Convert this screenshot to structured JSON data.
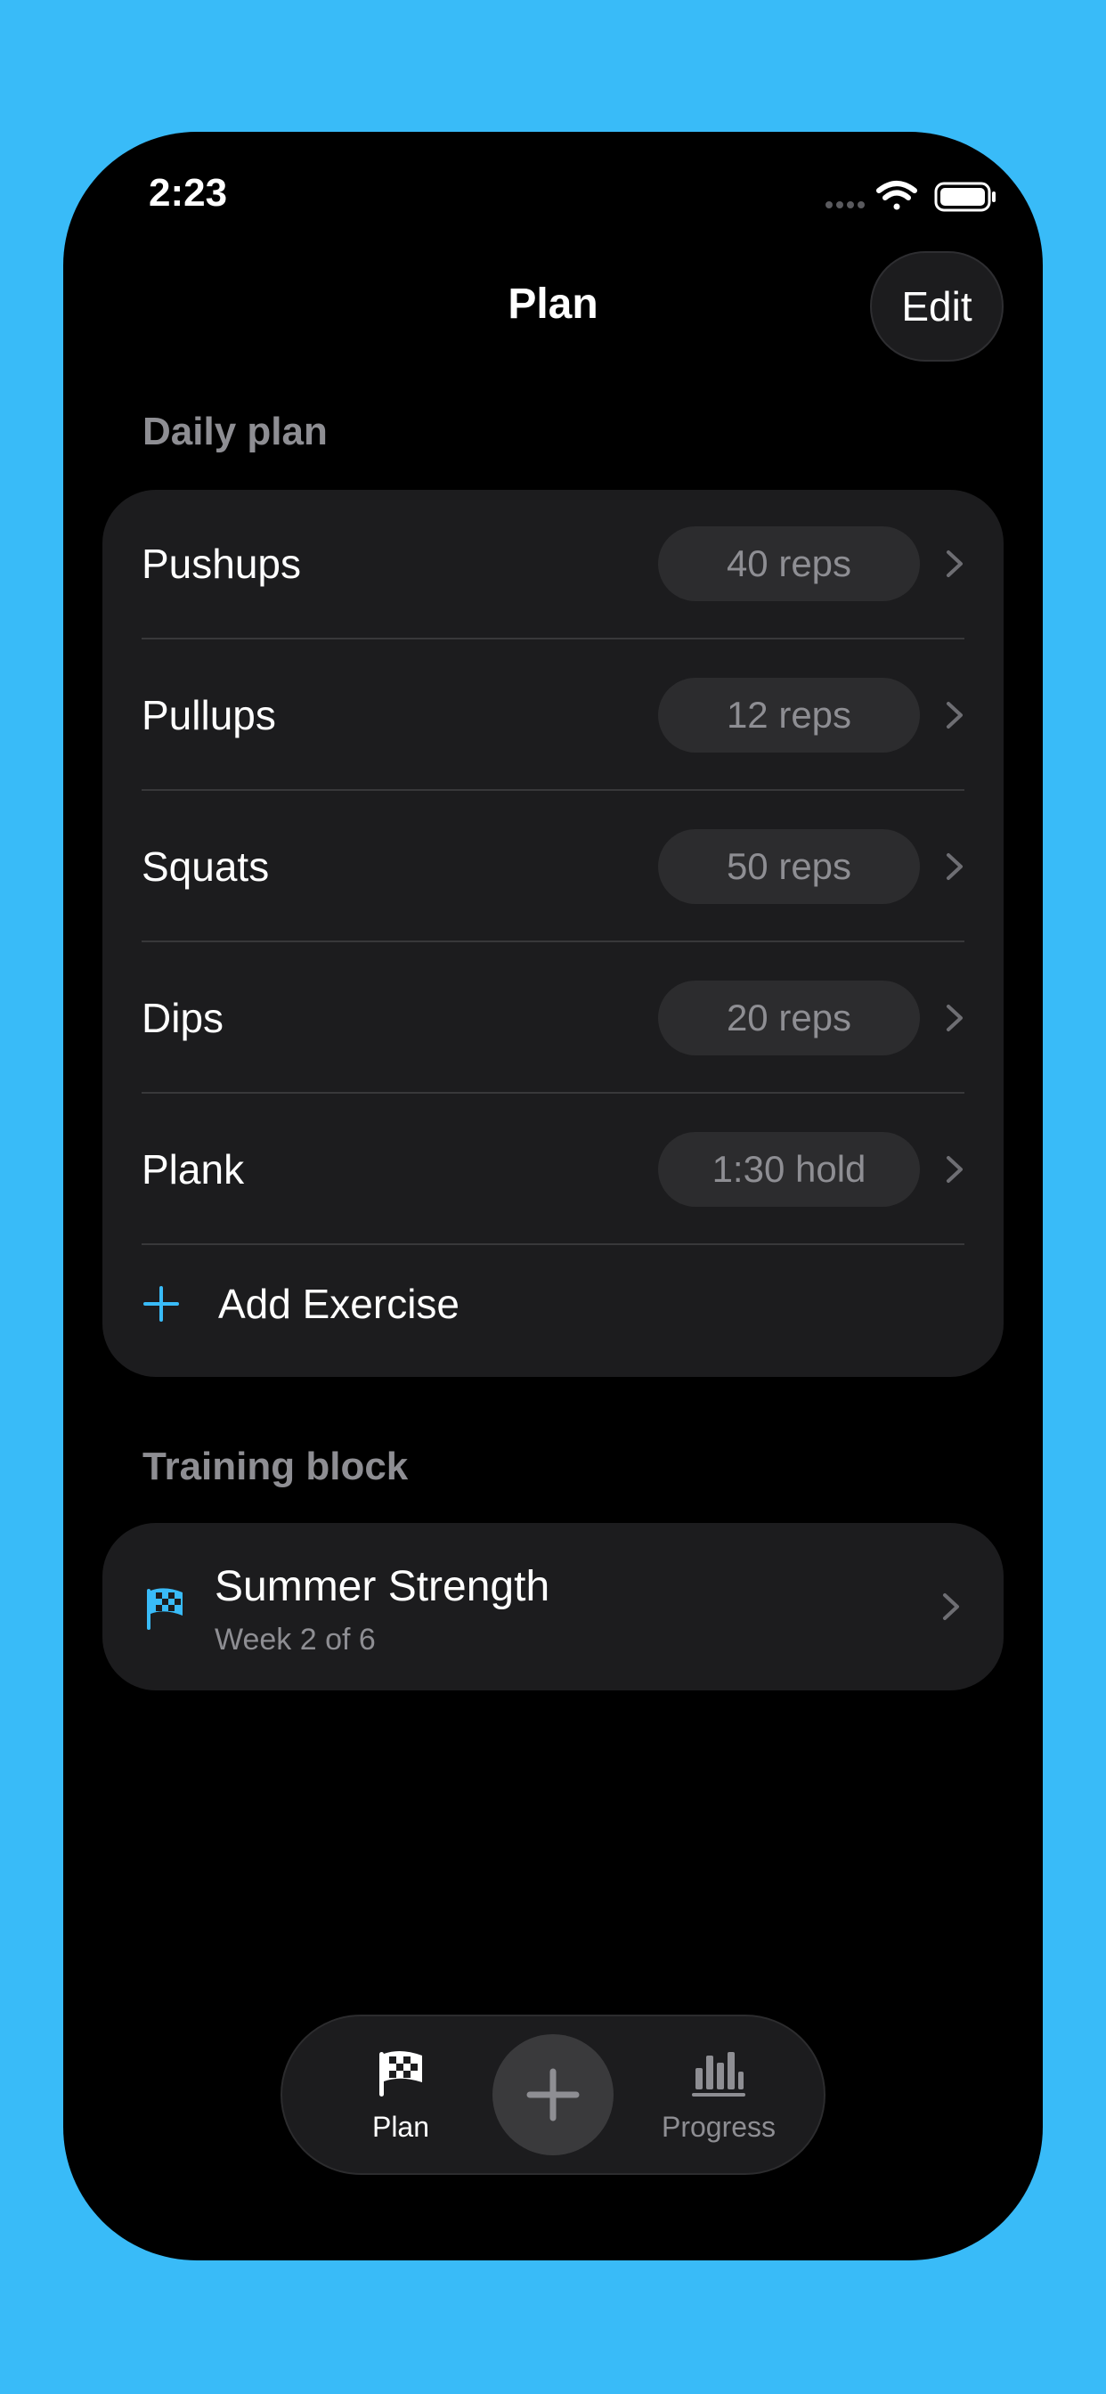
{
  "status": {
    "time": "2:23"
  },
  "nav": {
    "title": "Plan",
    "edit_label": "Edit"
  },
  "daily_plan": {
    "header": "Daily plan",
    "exercises": [
      {
        "name": "Pushups",
        "target": "40 reps"
      },
      {
        "name": "Pullups",
        "target": "12 reps"
      },
      {
        "name": "Squats",
        "target": "50 reps"
      },
      {
        "name": "Dips",
        "target": "20 reps"
      },
      {
        "name": "Plank",
        "target": "1:30 hold"
      }
    ],
    "add_label": "Add Exercise"
  },
  "training_block": {
    "header": "Training block",
    "title": "Summer Strength",
    "subtitle": "Week 2 of 6"
  },
  "tabbar": {
    "plan_label": "Plan",
    "progress_label": "Progress"
  },
  "colors": {
    "background": "#39BBF8",
    "accent": "#39BBF8",
    "card": "#1C1C1E",
    "pill": "#2C2C2E",
    "secondary_text": "#8E8E93"
  },
  "icons": {
    "status": [
      "cellular-dots-icon",
      "wifi-icon",
      "battery-icon"
    ],
    "row": "chevron-right-icon",
    "add": "plus-icon",
    "block": "checkered-flag-icon",
    "tabs": [
      "checkered-flag-icon",
      "plus-icon",
      "bar-chart-icon"
    ]
  }
}
